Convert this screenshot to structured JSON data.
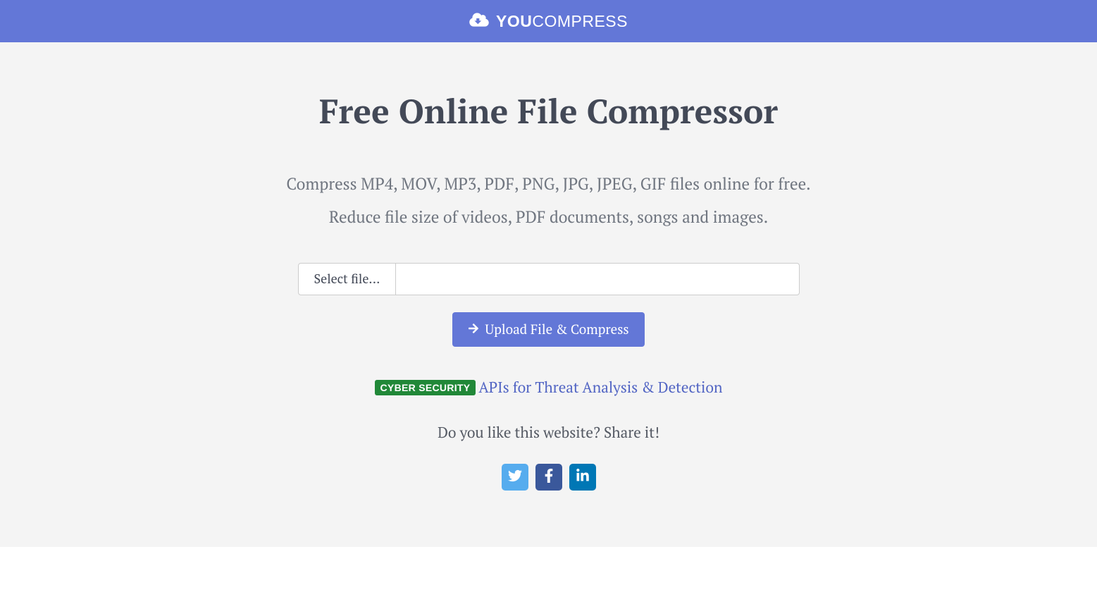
{
  "header": {
    "logo_bold": "YOU",
    "logo_light": "COMPRESS"
  },
  "hero": {
    "title": "Free Online File Compressor",
    "subtitle1": "Compress MP4, MOV, MP3, PDF, PNG, JPG, JPEG, GIF files online for free.",
    "subtitle2": "Reduce file size of videos, PDF documents, songs and images."
  },
  "form": {
    "select_label": "Select file...",
    "file_value": "",
    "upload_label": "Upload File & Compress"
  },
  "promo": {
    "badge": "CYBER SECURITY",
    "link_text": "APIs for Threat Analysis & Detection"
  },
  "share": {
    "prompt": "Do you like this website? Share it!"
  }
}
